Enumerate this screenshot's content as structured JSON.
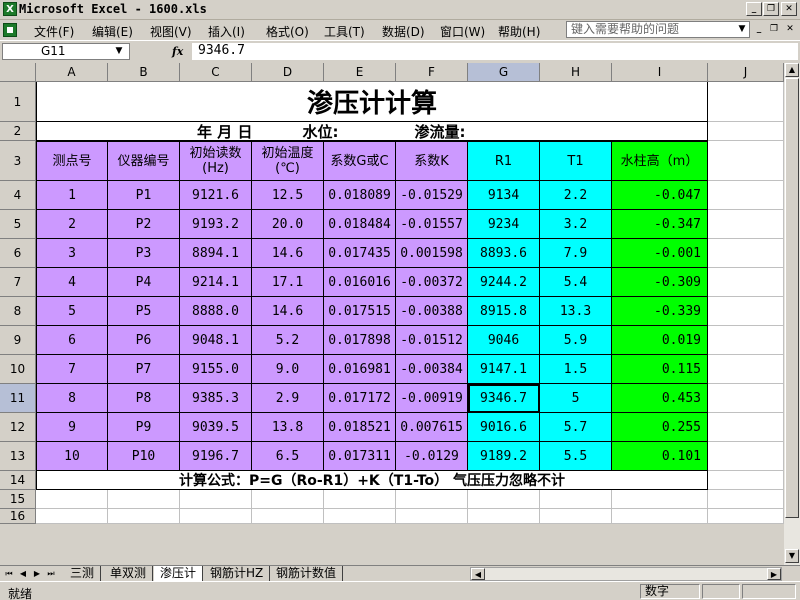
{
  "window": {
    "title": "Microsoft Excel - 1600.xls",
    "icon": "excel-icon",
    "controls": [
      "_",
      "❐",
      "✕"
    ]
  },
  "menu": {
    "items": [
      "文件(F)",
      "编辑(E)",
      "视图(V)",
      "插入(I)",
      "格式(O)",
      "工具(T)",
      "数据(D)",
      "窗口(W)",
      "帮助(H)"
    ],
    "help_placeholder": "键入需要帮助的问题",
    "doc_controls": [
      "_",
      "❐",
      "✕"
    ]
  },
  "formula_bar": {
    "cell_ref": "G11",
    "fx": "fx",
    "value": "9346.7"
  },
  "columns": [
    "A",
    "B",
    "C",
    "D",
    "E",
    "F",
    "G",
    "H",
    "I",
    "J"
  ],
  "selected_column": "G",
  "rows": [
    "1",
    "2",
    "3",
    "4",
    "5",
    "6",
    "7",
    "8",
    "9",
    "10",
    "11",
    "12",
    "13",
    "14",
    "15",
    "16"
  ],
  "selected_row": "11",
  "sheet": {
    "title": "渗压计计算",
    "subtitle": {
      "date": "年   月   日",
      "water_level": "水位:",
      "seepage": "渗流量:"
    },
    "headers": [
      "测点号",
      "仪器编号",
      "初始读数\n(Hz)",
      "初始温度\n(℃)",
      "系数G或C",
      "系数K",
      "R1",
      "T1",
      "水柱高（m）"
    ],
    "table_rows": [
      [
        "1",
        "P1",
        "9121.6",
        "12.5",
        "0.018089",
        "-0.01529",
        "9134",
        "2.2",
        "-0.047"
      ],
      [
        "2",
        "P2",
        "9193.2",
        "20.0",
        "0.018484",
        "-0.01557",
        "9234",
        "3.2",
        "-0.347"
      ],
      [
        "3",
        "P3",
        "8894.1",
        "14.6",
        "0.017435",
        "0.001598",
        "8893.6",
        "7.9",
        "-0.001"
      ],
      [
        "4",
        "P4",
        "9214.1",
        "17.1",
        "0.016016",
        "-0.00372",
        "9244.2",
        "5.4",
        "-0.309"
      ],
      [
        "5",
        "P5",
        "8888.0",
        "14.6",
        "0.017515",
        "-0.00388",
        "8915.8",
        "13.3",
        "-0.339"
      ],
      [
        "6",
        "P6",
        "9048.1",
        "5.2",
        "0.017898",
        "-0.01512",
        "9046",
        "5.9",
        "0.019"
      ],
      [
        "7",
        "P7",
        "9155.0",
        "9.0",
        "0.016981",
        "-0.00384",
        "9147.1",
        "1.5",
        "0.115"
      ],
      [
        "8",
        "P8",
        "9385.3",
        "2.9",
        "0.017172",
        "-0.00919",
        "9346.7",
        "5",
        "0.453"
      ],
      [
        "9",
        "P9",
        "9039.5",
        "13.8",
        "0.018521",
        "0.007615",
        "9016.6",
        "5.7",
        "0.255"
      ],
      [
        "10",
        "P10",
        "9196.7",
        "6.5",
        "0.017311",
        "-0.0129",
        "9189.2",
        "5.5",
        "0.101"
      ]
    ],
    "formula_note": "计算公式：P=G（Ro-R1）+K（T1-To）       气压压力忽略不计"
  },
  "tabs": {
    "nav": [
      "⏮",
      "◀",
      "▶",
      "⏭"
    ],
    "sheets": [
      "三测",
      "单双测",
      "渗压计",
      "钢筋计HZ",
      "钢筋计数值"
    ],
    "active": "渗压计"
  },
  "status": {
    "ready": "就绪",
    "mode": "数字"
  },
  "colors": {
    "purple": "#cc99ff",
    "cyan": "#00ffff",
    "green": "#00ff00",
    "selection_header": "#b6bfd6"
  }
}
